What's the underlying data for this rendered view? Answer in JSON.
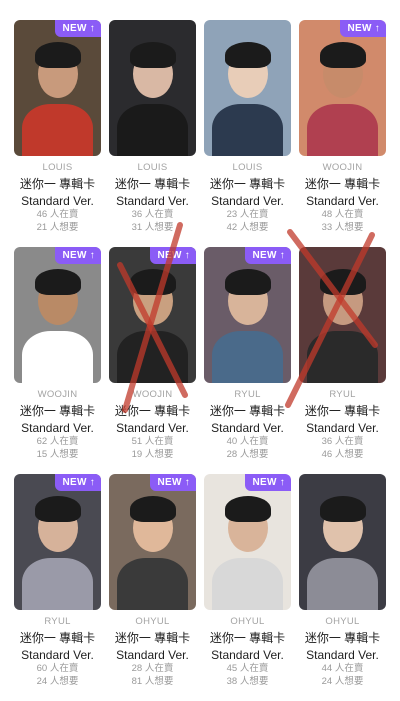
{
  "cards": [
    {
      "member": "LOUIS",
      "title": "迷你一 專輯卡",
      "version": "Standard Ver.",
      "selling": "46 人在賣",
      "wanting": "21 人想要",
      "is_new": true,
      "bg": "#5a4a3a",
      "skin": "#c89a7c",
      "body": "#c0392b"
    },
    {
      "member": "LOUIS",
      "title": "迷你一 專輯卡",
      "version": "Standard Ver.",
      "selling": "36 人在賣",
      "wanting": "31 人想要",
      "is_new": false,
      "bg": "#2b2b2e",
      "skin": "#d9b8a4",
      "body": "#1a1a1a"
    },
    {
      "member": "LOUIS",
      "title": "迷你一 專輯卡",
      "version": "Standard Ver.",
      "selling": "23 人在賣",
      "wanting": "42 人想要",
      "is_new": false,
      "bg": "#8fa3b8",
      "skin": "#e8cdb8",
      "body": "#2c3a4f"
    },
    {
      "member": "WOOJIN",
      "title": "迷你一 專輯卡",
      "version": "Standard Ver.",
      "selling": "48 人在賣",
      "wanting": "33 人想要",
      "is_new": true,
      "bg": "#d18a6b",
      "skin": "#c78b6a",
      "body": "#b04050"
    },
    {
      "member": "WOOJIN",
      "title": "迷你一 專輯卡",
      "version": "Standard Ver.",
      "selling": "62 人在賣",
      "wanting": "15 人想要",
      "is_new": true,
      "bg": "#8a8a8a",
      "skin": "#b98a66",
      "body": "#ffffff"
    },
    {
      "member": "WOOJIN",
      "title": "迷你一 專輯卡",
      "version": "Standard Ver.",
      "selling": "51 人在賣",
      "wanting": "19 人想要",
      "is_new": true,
      "bg": "#3a3a3a",
      "skin": "#c9a080",
      "body": "#222222"
    },
    {
      "member": "RYUL",
      "title": "迷你一 專輯卡",
      "version": "Standard Ver.",
      "selling": "40 人在賣",
      "wanting": "28 人想要",
      "is_new": true,
      "bg": "#6a5c68",
      "skin": "#d8b49a",
      "body": "#4a6a8a"
    },
    {
      "member": "RYUL",
      "title": "迷你一 專輯卡",
      "version": "Standard Ver.",
      "selling": "36 人在賣",
      "wanting": "46 人想要",
      "is_new": false,
      "bg": "#5a3a3a",
      "skin": "#c69a80",
      "body": "#2a2a2a"
    },
    {
      "member": "RYUL",
      "title": "迷你一 專輯卡",
      "version": "Standard Ver.",
      "selling": "60 人在賣",
      "wanting": "24 人想要",
      "is_new": true,
      "bg": "#4a4a52",
      "skin": "#d6b29a",
      "body": "#9a9aa8"
    },
    {
      "member": "OHYUL",
      "title": "迷你一 專輯卡",
      "version": "Standard Ver.",
      "selling": "28 人在賣",
      "wanting": "81 人想要",
      "is_new": true,
      "bg": "#7a6a5e",
      "skin": "#e0b89a",
      "body": "#3a3a3a"
    },
    {
      "member": "OHYUL",
      "title": "迷你一 專輯卡",
      "version": "Standard Ver.",
      "selling": "45 人在賣",
      "wanting": "38 人想要",
      "is_new": true,
      "bg": "#e8e4de",
      "skin": "#d9b49a",
      "body": "#d8d8d8"
    },
    {
      "member": "OHYUL",
      "title": "迷你一 專輯卡",
      "version": "Standard Ver.",
      "selling": "44 人在賣",
      "wanting": "24 人想要",
      "is_new": false,
      "bg": "#3c3c44",
      "skin": "#e0c2ac",
      "body": "#8c8c96"
    }
  ],
  "badge": {
    "label": "NEW",
    "arrow": "↑"
  },
  "accent": "#8b5cf6",
  "cross_color": "#c0392b"
}
